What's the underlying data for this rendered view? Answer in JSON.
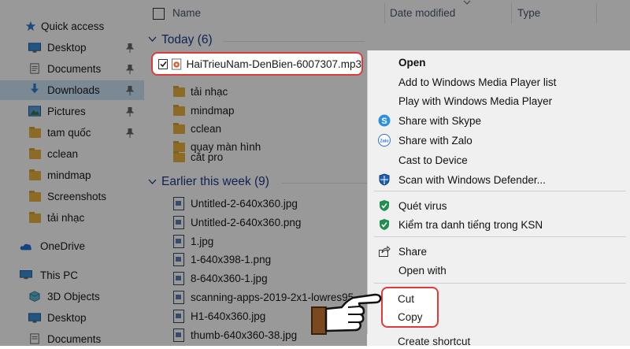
{
  "sidebar": {
    "quick_access": "Quick access",
    "items": [
      {
        "label": "Desktop",
        "icon": "desktop-icon",
        "pinned": true
      },
      {
        "label": "Documents",
        "icon": "documents-icon",
        "pinned": true
      },
      {
        "label": "Downloads",
        "icon": "downloads-icon",
        "pinned": true,
        "selected": true
      },
      {
        "label": "Pictures",
        "icon": "pictures-icon",
        "pinned": true
      },
      {
        "label": "tam quốc",
        "icon": "folder-icon",
        "pinned": true
      },
      {
        "label": "cclean",
        "icon": "folder-icon"
      },
      {
        "label": "mindmap",
        "icon": "folder-icon"
      },
      {
        "label": "Screenshots",
        "icon": "folder-icon"
      },
      {
        "label": "tải nhạc",
        "icon": "folder-icon"
      }
    ],
    "onedrive": "OneDrive",
    "this_pc": "This PC",
    "pc_items": [
      {
        "label": "3D Objects",
        "icon": "3d-objects-icon"
      },
      {
        "label": "Desktop",
        "icon": "desktop-icon"
      },
      {
        "label": "Documents",
        "icon": "documents-icon"
      }
    ]
  },
  "header": {
    "name": "Name",
    "date_modified": "Date modified",
    "type": "Type"
  },
  "groups": {
    "today": {
      "label": "Today (6)",
      "files": [
        {
          "name": "HaiTrieuNam-DenBien-6007307.mp3",
          "icon": "audio-file-icon",
          "checked": true
        },
        {
          "name": "tải nhạc",
          "icon": "folder-icon"
        },
        {
          "name": "mindmap",
          "icon": "folder-icon"
        },
        {
          "name": "cclean",
          "icon": "folder-icon"
        },
        {
          "name": "quay màn hình",
          "icon": "folder-icon"
        },
        {
          "name": "cắt pro",
          "icon": "folder-icon"
        }
      ]
    },
    "earlier": {
      "label": "Earlier this week (9)",
      "files": [
        {
          "name": "Untitled-2-640x360.jpg",
          "icon": "image-file-icon"
        },
        {
          "name": "Untitled-2-640x360.png",
          "icon": "image-file-icon"
        },
        {
          "name": "1.jpg",
          "icon": "image-file-icon"
        },
        {
          "name": "1-640x398-1.png",
          "icon": "image-file-icon"
        },
        {
          "name": "8-640x360-1.jpg",
          "icon": "image-file-icon"
        },
        {
          "name": "scanning-apps-2019-2x1-lowres95",
          "icon": "image-file-icon"
        },
        {
          "name": "H1-640x360.jpg",
          "icon": "image-file-icon"
        },
        {
          "name": "thumb-640x360-38.jpg",
          "icon": "image-file-icon"
        }
      ]
    }
  },
  "context_menu": {
    "items": [
      {
        "label": "Open",
        "bold": true
      },
      {
        "label": "Add to Windows Media Player list"
      },
      {
        "label": "Play with Windows Media Player"
      },
      {
        "label": "Share with Skype",
        "icon": "skype-icon"
      },
      {
        "label": "Share with Zalo",
        "icon": "zalo-icon"
      },
      {
        "label": "Cast to Device"
      },
      {
        "label": "Scan with Windows Defender...",
        "icon": "defender-icon"
      },
      {
        "label": "Quét virus",
        "icon": "kaspersky-shield-icon"
      },
      {
        "label": "Kiểm tra danh tiếng trong KSN",
        "icon": "kaspersky-shield-icon"
      },
      {
        "label": "Share",
        "icon": "share-icon"
      },
      {
        "label": "Open with"
      },
      {
        "label": "Cut"
      },
      {
        "label": "Copy"
      },
      {
        "label": "Create shortcut"
      }
    ],
    "zalo_text": "Zalo"
  },
  "colors": {
    "highlight_border": "#e03a3a",
    "group_header": "#1e3a8a",
    "folder": "#e8b23e",
    "selection": "#cce4f7"
  }
}
